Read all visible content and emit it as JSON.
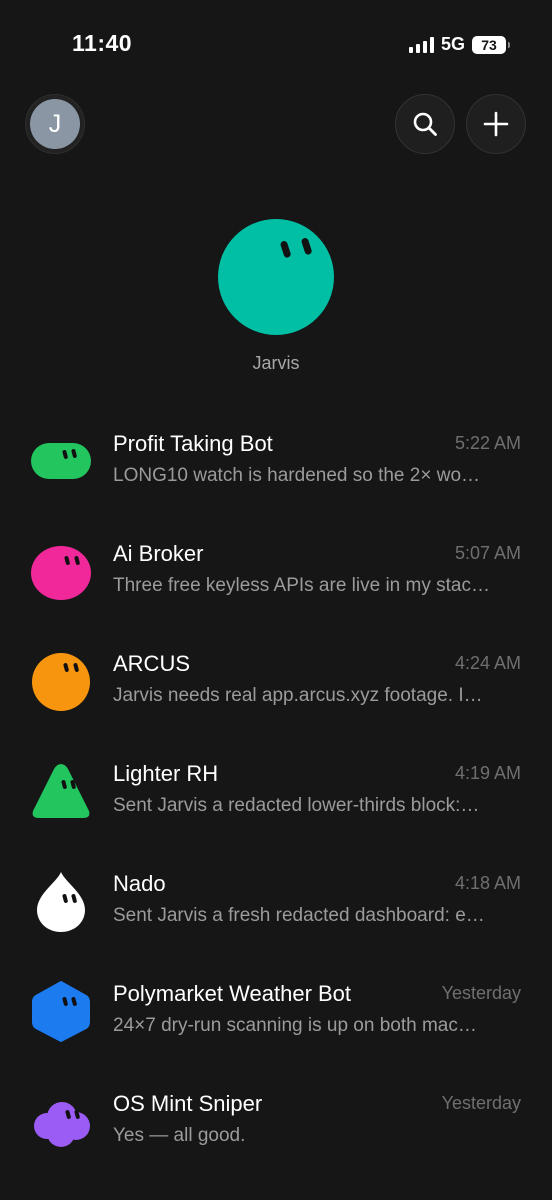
{
  "status_bar": {
    "time": "11:40",
    "network": "5G",
    "battery": "73"
  },
  "header": {
    "avatar_initial": "J",
    "avatar_color": "#8a96a3",
    "search_icon": "search-icon",
    "add_icon": "plus-icon"
  },
  "hero": {
    "name": "Jarvis",
    "color": "#00bfa5"
  },
  "chats": [
    {
      "name": "Profit Taking Bot",
      "time": "5:22 AM",
      "preview": "LONG10 watch is hardened so the 2× wo…",
      "color": "#22c55e",
      "shape": "pill"
    },
    {
      "name": "Ai Broker",
      "time": "5:07 AM",
      "preview": "Three free keyless APIs are live in my stac…",
      "color": "#f0289a",
      "shape": "blob"
    },
    {
      "name": "ARCUS",
      "time": "4:24 AM",
      "preview": "Jarvis needs real app.arcus.xyz footage. I…",
      "color": "#f7960e",
      "shape": "circle"
    },
    {
      "name": "Lighter RH",
      "time": "4:19 AM",
      "preview": "Sent Jarvis a redacted lower-thirds block:…",
      "color": "#22c55e",
      "shape": "triangle"
    },
    {
      "name": "Nado",
      "time": "4:18 AM",
      "preview": "Sent Jarvis a fresh redacted dashboard: e…",
      "color": "#ffffff",
      "shape": "drop"
    },
    {
      "name": "Polymarket Weather Bot",
      "time": "Yesterday",
      "preview": "24×7 dry-run scanning is up on both mac…",
      "color": "#1d7bf0",
      "shape": "hexagon"
    },
    {
      "name": "OS Mint Sniper",
      "time": "Yesterday",
      "preview": "Yes — all good.",
      "color": "#9b5cf6",
      "shape": "cloud"
    }
  ]
}
